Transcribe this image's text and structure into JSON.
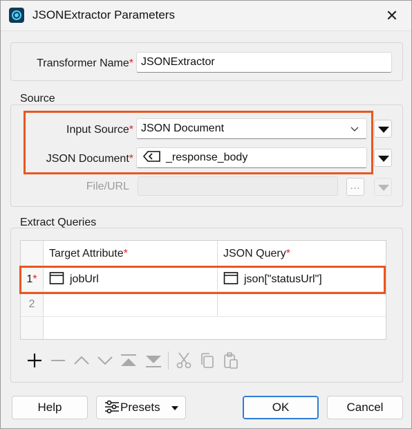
{
  "window": {
    "title": "JSONExtractor Parameters"
  },
  "transformer": {
    "label": "Transformer Name",
    "value": "JSONExtractor"
  },
  "source": {
    "group_label": "Source",
    "input_source": {
      "label": "Input Source",
      "value": "JSON Document"
    },
    "json_document": {
      "label": "JSON Document",
      "value": "_response_body"
    },
    "file_url": {
      "label": "File/URL",
      "value": "",
      "ellipsis": "..."
    }
  },
  "extract_queries": {
    "group_label": "Extract Queries",
    "columns": [
      "Target Attribute",
      "JSON Query"
    ],
    "rows": [
      {
        "num": "1",
        "target_attribute": "jobUrl",
        "json_query": "json[\"statusUrl\"]"
      },
      {
        "num": "2",
        "target_attribute": "",
        "json_query": ""
      }
    ]
  },
  "required_marker": "*",
  "buttons": {
    "help": "Help",
    "presets": "Presets",
    "ok": "OK",
    "cancel": "Cancel"
  },
  "colors": {
    "highlight": "#e8571e",
    "required": "#d9232d",
    "ok_border": "#2f7bd6"
  }
}
